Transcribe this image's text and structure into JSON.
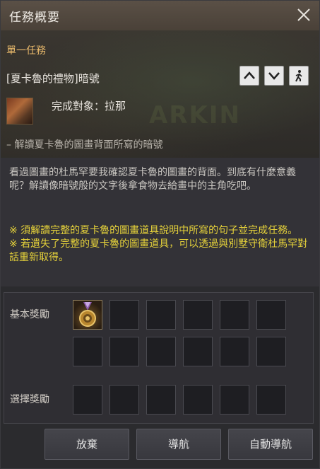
{
  "window": {
    "title": "任務概要"
  },
  "quest": {
    "category": "單一任務",
    "name": "[夏卡魯的禮物]暗號",
    "target_label": "完成對象：拉那",
    "objective": "– 解讀夏卡魯的圖畫背面所寫的暗號",
    "description": "看過圖畫的杜馬罕要我確認夏卡魯的圖畫的背面。到底有什麼意義呢？解讀像暗號般的文字後拿食物去給畫中的主角吃吧。",
    "note1": "※ 須解讀完整的夏卡魯的圖畫道具說明中所寫的句子並完成任務。",
    "note2": "※ 若遺失了完整的夏卡魯的圖畫道具，可以透過與別墅守衛杜馬罕對話重新取得。"
  },
  "rewards": {
    "basic_label": "基本獎勵",
    "choice_label": "選擇獎勵",
    "basic_filled_count": 1
  },
  "buttons": {
    "abandon": "放棄",
    "navigate": "導航",
    "auto_navigate": "自動導航"
  },
  "icons": {
    "close": "close-icon",
    "up": "chevron-up-icon",
    "down": "chevron-down-icon",
    "walk": "walk-icon",
    "medal": "medal-icon"
  },
  "colors": {
    "category": "#e8b96b",
    "notes": "#e6d23a",
    "titlebar": "#4f463c"
  }
}
